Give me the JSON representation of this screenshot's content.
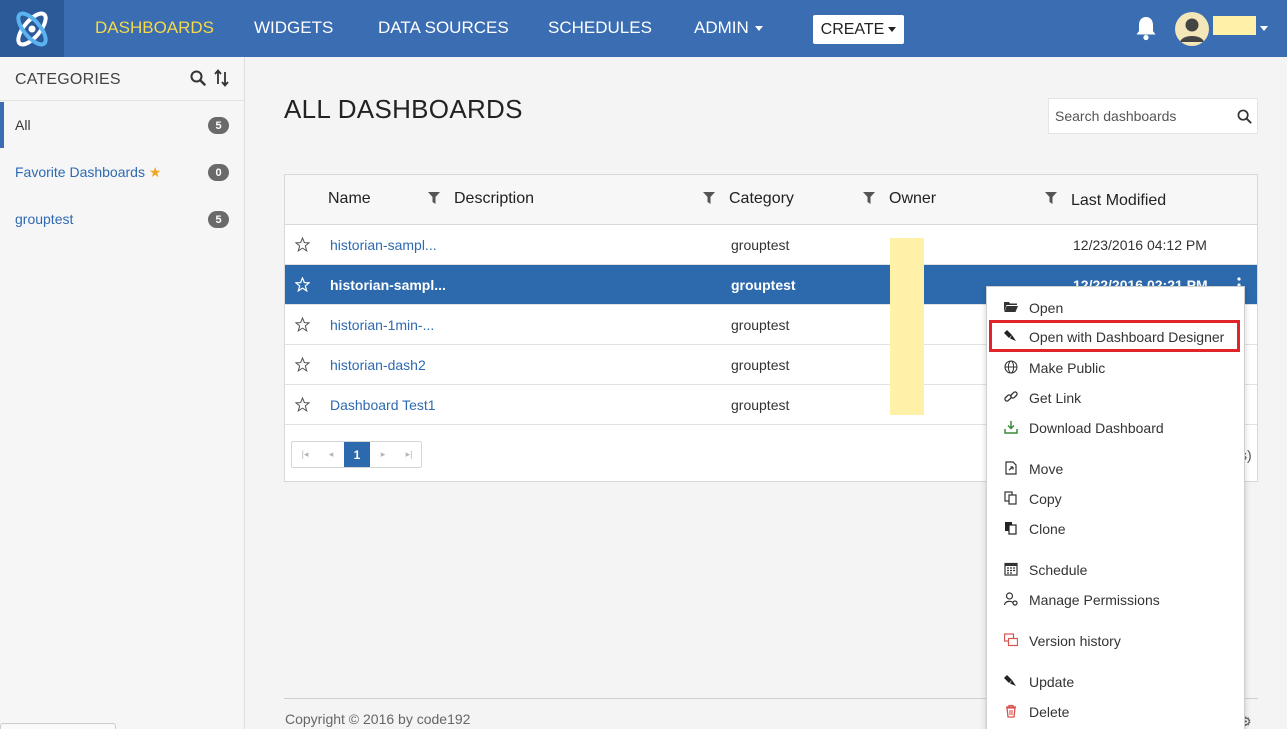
{
  "nav": {
    "items": [
      {
        "label": "DASHBOARDS"
      },
      {
        "label": "WIDGETS"
      },
      {
        "label": "DATA SOURCES"
      },
      {
        "label": "SCHEDULES"
      },
      {
        "label": "ADMIN"
      }
    ],
    "create_label": "CREATE",
    "accent_color": "#f6d94a",
    "bar_color": "#3a6db2"
  },
  "sidebar": {
    "title": "CATEGORIES",
    "items": [
      {
        "label": "All",
        "count": "5"
      },
      {
        "label": "Favorite Dashboards",
        "count": "0"
      },
      {
        "label": "grouptest",
        "count": "5"
      }
    ]
  },
  "main": {
    "title": "ALL DASHBOARDS",
    "search_placeholder": "Search dashboards",
    "columns": {
      "name": "Name",
      "description": "Description",
      "category": "Category",
      "owner": "Owner",
      "modified": "Last Modified"
    },
    "rows": [
      {
        "name": "historian-sampl...",
        "category": "grouptest",
        "modified": "12/23/2016 04:12 PM"
      },
      {
        "name": "historian-sampl...",
        "category": "grouptest",
        "modified": "12/22/2016 02:21 PM"
      },
      {
        "name": "historian-1min-...",
        "category": "grouptest",
        "modified": ""
      },
      {
        "name": "historian-dash2",
        "category": "grouptest",
        "modified": ""
      },
      {
        "name": "Dashboard Test1",
        "category": "grouptest",
        "modified": ""
      }
    ],
    "page": "1",
    "pager_tail": "s)",
    "copyright": "Copyright © 2016 by code192"
  },
  "menu": {
    "items": [
      {
        "label": "Open"
      },
      {
        "label": "Open with Dashboard Designer"
      },
      {
        "label": "Make Public"
      },
      {
        "label": "Get Link"
      },
      {
        "label": "Download Dashboard"
      },
      {
        "label": "Move"
      },
      {
        "label": "Copy"
      },
      {
        "label": "Clone"
      },
      {
        "label": "Schedule"
      },
      {
        "label": "Manage Permissions"
      },
      {
        "label": "Version history"
      },
      {
        "label": "Update"
      },
      {
        "label": "Delete"
      }
    ],
    "highlight_color": "#e0242a"
  }
}
